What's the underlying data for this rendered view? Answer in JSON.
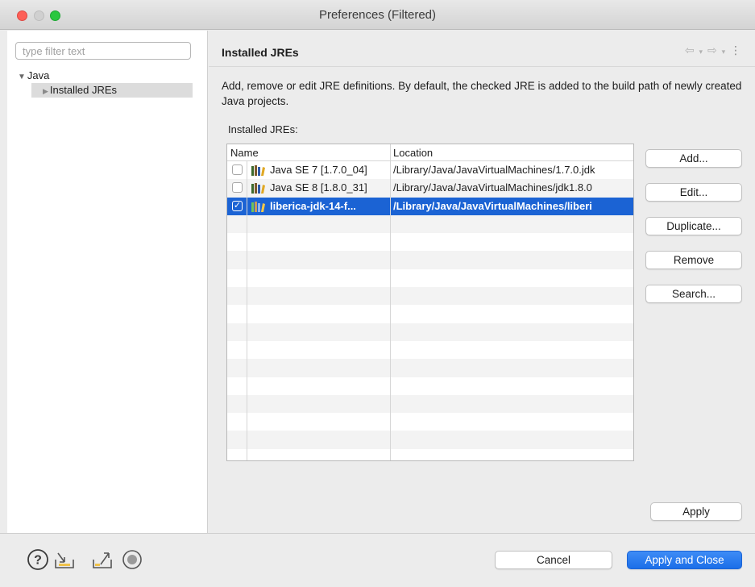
{
  "window": {
    "title": "Preferences (Filtered)"
  },
  "sidebar": {
    "filter_placeholder": "type filter text",
    "tree": [
      {
        "label": "Java",
        "expanded": true
      },
      {
        "label": "Installed JREs",
        "selected": true
      }
    ]
  },
  "page": {
    "title": "Installed JREs",
    "nav": {
      "back": "⇦",
      "forward": "⇨",
      "menu": "⋮"
    },
    "description": "Add, remove or edit JRE definitions. By default, the checked JRE is added to the build path of newly created Java projects.",
    "table_label": "Installed JREs:",
    "columns": {
      "name": "Name",
      "location": "Location"
    },
    "rows": [
      {
        "checked": false,
        "name": "Java SE 7 [1.7.0_04]",
        "location": "/Library/Java/JavaVirtualMachines/1.7.0.jdk"
      },
      {
        "checked": false,
        "name": "Java SE 8 [1.8.0_31]",
        "location": "/Library/Java/JavaVirtualMachines/jdk1.8.0"
      },
      {
        "checked": true,
        "selected": true,
        "name": "liberica-jdk-14-f...",
        "location": "/Library/Java/JavaVirtualMachines/liberi"
      }
    ],
    "buttons": {
      "add": "Add...",
      "edit": "Edit...",
      "duplicate": "Duplicate...",
      "remove": "Remove",
      "search": "Search..."
    },
    "apply": "Apply"
  },
  "footer": {
    "icons": [
      "help-icon",
      "import-icon",
      "export-icon",
      "record-icon"
    ],
    "cancel": "Cancel",
    "apply_close": "Apply and Close"
  },
  "colors": {
    "selection": "#1b63d4",
    "primary_button": "#1b6ee8",
    "close_light": "#fd5f57",
    "max_light": "#29c73f"
  }
}
